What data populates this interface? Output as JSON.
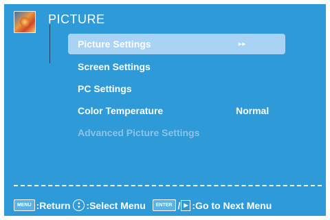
{
  "header": {
    "title": "PICTURE",
    "icon": "picture-icon"
  },
  "menu": {
    "items": [
      {
        "label": "Picture Settings",
        "selected": true,
        "arrow": "▸▸"
      },
      {
        "label": "Screen Settings"
      },
      {
        "label": "PC Settings"
      },
      {
        "label": "Color Temperature",
        "value": "Normal"
      },
      {
        "label": "Advanced Picture Settings",
        "disabled": true
      }
    ]
  },
  "footer": {
    "menu_key": "MENU",
    "return_label": ":Return",
    "select_label": ":Select Menu",
    "enter_key": "ENTER",
    "next_label": ":Go to Next Menu"
  },
  "colors": {
    "background": "#2f9ad8",
    "highlight": "#a9d3f4",
    "disabled_text": "#8dc3e6"
  }
}
